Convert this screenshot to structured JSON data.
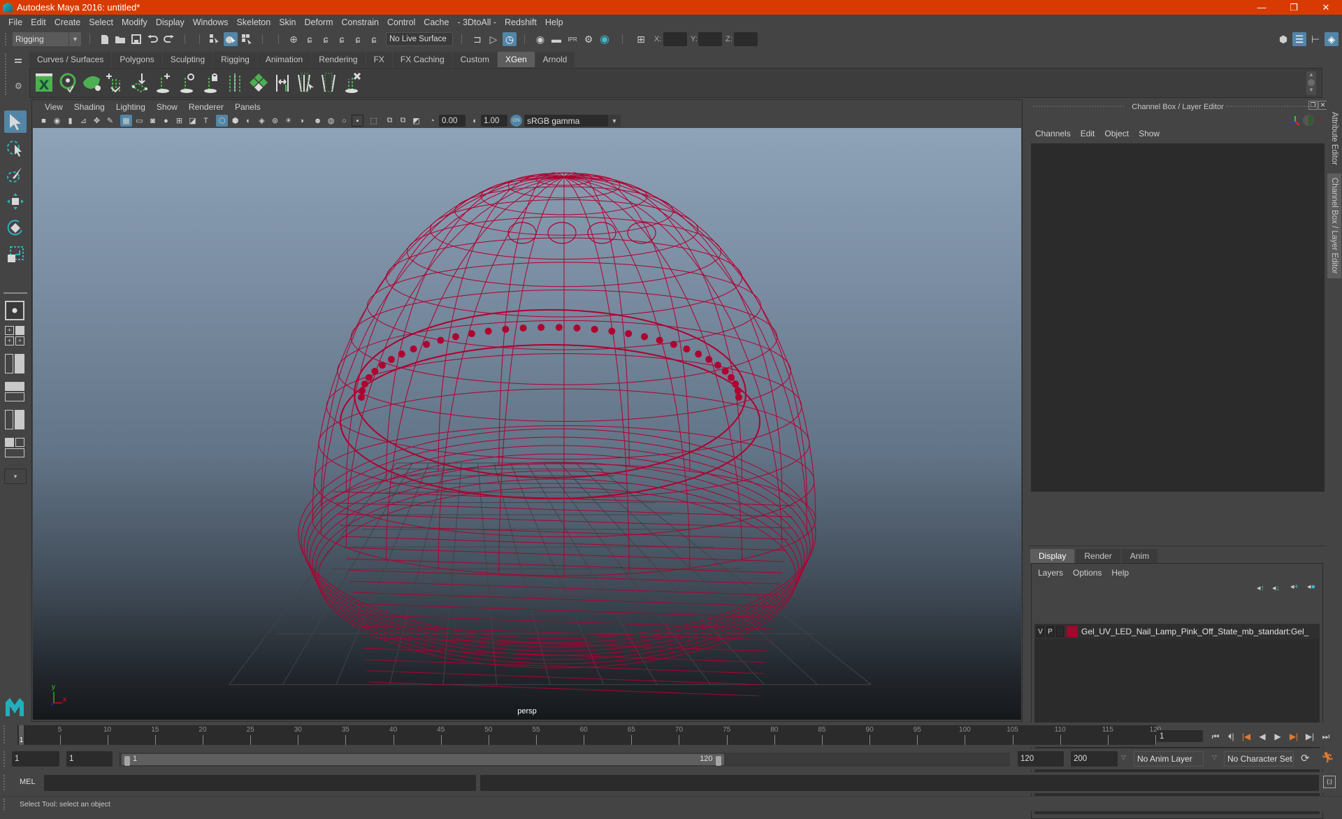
{
  "window": {
    "title": "Autodesk Maya 2016: untitled*",
    "controls": {
      "minimize": "—",
      "restore": "❐",
      "close": "✕"
    }
  },
  "menubar": [
    "File",
    "Edit",
    "Create",
    "Select",
    "Modify",
    "Display",
    "Windows",
    "Skeleton",
    "Skin",
    "Deform",
    "Constrain",
    "Control",
    "Cache",
    "- 3DtoAll -",
    "Redshift",
    "Help"
  ],
  "statusline": {
    "menuset": "Rigging",
    "live_surface": "No Live Surface",
    "x_label": "X:",
    "y_label": "Y:",
    "z_label": "Z:",
    "x_value": "",
    "y_value": "",
    "z_value": ""
  },
  "shelf": {
    "tabs": [
      "Curves / Surfaces",
      "Polygons",
      "Sculpting",
      "Rigging",
      "Animation",
      "Rendering",
      "FX",
      "FX Caching",
      "Custom",
      "XGen",
      "Arnold"
    ],
    "active_tab": "XGen",
    "icons": [
      "xgen-editor-icon",
      "create-description-icon",
      "create-patches-icon",
      "add-guides-icon",
      "place-guides-icon",
      "add-guide-icon",
      "select-guide-icon",
      "lock-guide-icon",
      "guide-curves-icon",
      "rebuild-guides-icon",
      "sculpt-guides-icon",
      "guides-to-curves-icon",
      "curves-to-guides-icon",
      "delete-guides-icon"
    ]
  },
  "panel": {
    "menu": [
      "View",
      "Shading",
      "Lighting",
      "Show",
      "Renderer",
      "Panels"
    ],
    "exposure": "0.00",
    "gamma": "1.00",
    "colorspace": "sRGB gamma",
    "camera_label": "persp",
    "axis": {
      "y": "y",
      "x": "x",
      "z": "z"
    }
  },
  "rightpanel": {
    "title": "Channel Box / Layer Editor",
    "channel_menu": [
      "Channels",
      "Edit",
      "Object",
      "Show"
    ],
    "layer_tabs": [
      "Display",
      "Render",
      "Anim"
    ],
    "active_layer_tab": "Display",
    "layer_menu": [
      "Layers",
      "Options",
      "Help"
    ],
    "layers": [
      {
        "visible": "V",
        "playback": "P",
        "color": "#9c0a2e",
        "name": "Gel_UV_LED_Nail_Lamp_Pink_Off_State_mb_standart:Gel_"
      }
    ],
    "side_tabs": [
      "Attribute Editor",
      "Channel Box / Layer Editor"
    ]
  },
  "timeslider": {
    "ticks": [
      5,
      10,
      15,
      20,
      25,
      30,
      35,
      40,
      45,
      50,
      55,
      60,
      65,
      70,
      75,
      80,
      85,
      90,
      95,
      100,
      105,
      110,
      115,
      120
    ],
    "start": 1,
    "end": 120,
    "current_frame": "1",
    "current_marker": "1"
  },
  "rangeslider": {
    "start_time": "1",
    "playback_start": "1",
    "range_start_label": "1",
    "range_end_label": "120",
    "playback_end": "120",
    "end_time": "200",
    "anim_layer": "No Anim Layer",
    "character_set": "No Character Set"
  },
  "commandline": {
    "label": "MEL",
    "value": ""
  },
  "helpline": "Select Tool: select an object",
  "colors": {
    "titlebar": "#d83b01",
    "accent": "#5285a6",
    "wireframe": "#b0002f",
    "xgen_green": "#4caf50"
  }
}
